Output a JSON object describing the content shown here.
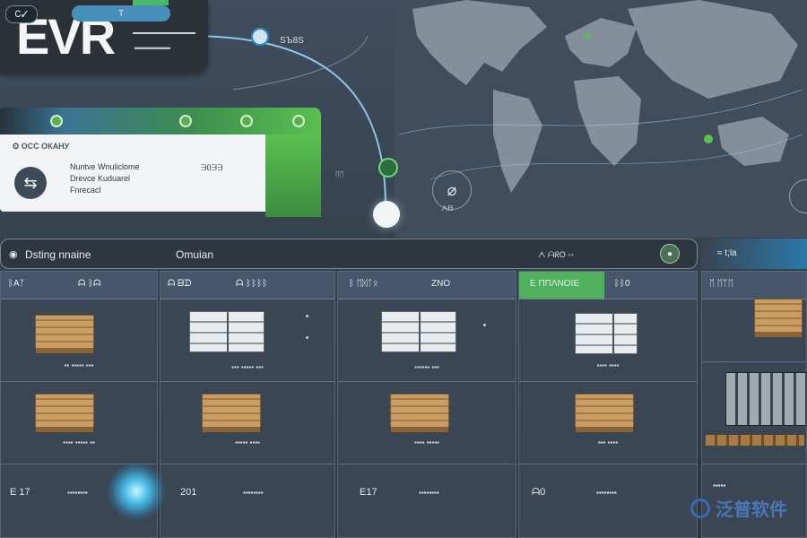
{
  "header": {
    "logo_text": "EVR",
    "route_label": "SЪ8S",
    "logo_small_text": "▬▬▬▬▬"
  },
  "left_panel": {
    "tabs": [
      "Ꮯ✓",
      "T",
      "●",
      "●",
      "●"
    ],
    "info_card": {
      "title": "Ꙩ ОСС ОКAНУ",
      "lines": [
        "Nuntve Wnuliclome",
        "Drevce Kuduarel",
        "Fnrecacl"
      ],
      "value": "ᗱ0ᗱᗱ"
    }
  },
  "map_overlay": {
    "node_label": "ᛖᛖ",
    "stat_label": "ᗅᗷ"
  },
  "search_bar": {
    "text_left": "Dsting  nnaine",
    "text_mid": "Omuian",
    "text_right": "ᗅ ᗩᖇO ◦◦",
    "button_icon": "●"
  },
  "side_card": {
    "label": "≈  t;la"
  },
  "columns": [
    {
      "head": [
        "ᛒAᛉ",
        "ᗩ ᛒᗩ"
      ],
      "row1_label": "▪▪ ▪▪▪▪▪ ▪▪▪",
      "row2_label": "▪▪▪▪ ▪▪▪▪▪ ▪▪",
      "bottom_left": "E 17",
      "bottom_right": "▪▪▪▪▪▪▪▪"
    },
    {
      "head": [
        "ᗩ ᗷᗪ",
        "ᗩ ᛒᛒᛒᛒ"
      ],
      "row1_label": "▪▪▪ ▪▪▪▪▪ ▪▪▪",
      "row2_label": "▪▪▪▪▪ ▪▪▪▪",
      "bottom_left": "201",
      "bottom_right": "▪▪▪▪▪▪▪▪"
    },
    {
      "head": [
        "ᛒ ᛖᛞᛏᛟ",
        "ZNO"
      ],
      "row1_label": "▪▪▪▪▪▪ ▪▪▪",
      "row2_label": "▪▪▪▪ ▪▪▪▪▪",
      "bottom_left": "E17",
      "bottom_right": "▪▪▪▪▪▪▪▪"
    },
    {
      "head": [
        "E ΠΠΛΝΟΙΕ",
        "ᛒᛒ0"
      ],
      "row1_label": "▪▪▪▪ ▪▪▪▪",
      "row2_label": "▪▪▪ ▪▪▪▪",
      "bottom_left": "ᗩ0",
      "bottom_right": "▪▪▪▪▪▪▪▪"
    },
    {
      "head": [
        "ᛖ ᛖᛉᛖ"
      ],
      "row1_label": "",
      "row2_label": "",
      "bottom_left": "▪▪▪▪▪",
      "bottom_right": ""
    }
  ],
  "watermark": {
    "text": "泛普软件"
  }
}
